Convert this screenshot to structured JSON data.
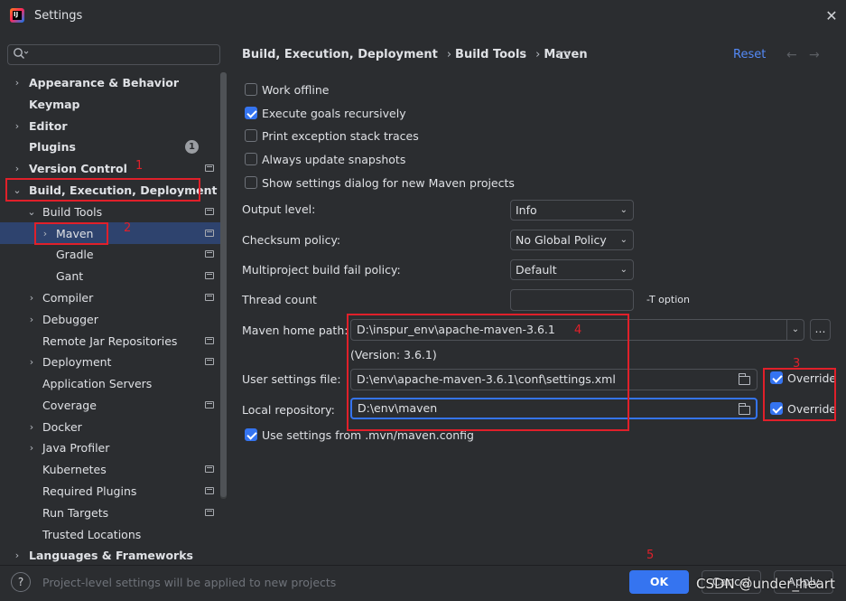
{
  "window": {
    "title": "Settings",
    "close": "✕",
    "app_icon_text": "IJ"
  },
  "sidebar": {
    "search_placeholder": "",
    "items": [
      {
        "label": "Appearance & Behavior",
        "expandable": true,
        "level": 0
      },
      {
        "label": "Keymap",
        "level": 0
      },
      {
        "label": "Editor",
        "expandable": true,
        "level": 0
      },
      {
        "label": "Plugins",
        "level": 0,
        "badge": "1"
      },
      {
        "label": "Version Control",
        "expandable": true,
        "level": 0
      },
      {
        "label": "Build, Execution, Deployment",
        "expanded": true,
        "level": 0
      },
      {
        "label": "Build Tools",
        "expanded": true,
        "level": 1
      },
      {
        "label": "Maven",
        "expandable": true,
        "level": 2,
        "selected": true
      },
      {
        "label": "Gradle",
        "level": 2
      },
      {
        "label": "Gant",
        "level": 2
      },
      {
        "label": "Compiler",
        "expandable": true,
        "level": 1
      },
      {
        "label": "Debugger",
        "expandable": true,
        "level": 1
      },
      {
        "label": "Remote Jar Repositories",
        "level": 1
      },
      {
        "label": "Deployment",
        "expandable": true,
        "level": 1
      },
      {
        "label": "Application Servers",
        "level": 1
      },
      {
        "label": "Coverage",
        "level": 1
      },
      {
        "label": "Docker",
        "expandable": true,
        "level": 1
      },
      {
        "label": "Java Profiler",
        "expandable": true,
        "level": 1
      },
      {
        "label": "Kubernetes",
        "level": 1
      },
      {
        "label": "Required Plugins",
        "level": 1
      },
      {
        "label": "Run Targets",
        "level": 1
      },
      {
        "label": "Trusted Locations",
        "level": 1
      },
      {
        "label": "Languages & Frameworks",
        "expandable": true,
        "level": 0
      }
    ]
  },
  "header": {
    "breadcrumb": [
      "Build, Execution, Deployment",
      "Build Tools",
      "Maven"
    ],
    "reset": "Reset",
    "back": "←",
    "forward": "→"
  },
  "maven": {
    "work_offline": {
      "label": "Work offline",
      "checked": false
    },
    "execute_recursive": {
      "label": "Execute goals recursively",
      "checked": true
    },
    "print_exception": {
      "label": "Print exception stack traces",
      "checked": false
    },
    "always_update": {
      "label": "Always update snapshots",
      "checked": false
    },
    "show_dialog": {
      "label": "Show settings dialog for new Maven projects",
      "checked": false
    },
    "output_level": {
      "label": "Output level:",
      "value": "Info"
    },
    "checksum_policy": {
      "label": "Checksum policy:",
      "value": "No Global Policy"
    },
    "multiproject_policy": {
      "label": "Multiproject build fail policy:",
      "value": "Default"
    },
    "thread_count": {
      "label": "Thread count",
      "value": "",
      "suffix": "-T option"
    },
    "home_path": {
      "label": "Maven home path:",
      "value": "D:\\inspur_env\\apache-maven-3.6.1",
      "version": "(Version: 3.6.1)",
      "browse": "..."
    },
    "user_settings": {
      "label": "User settings file:",
      "value": "D:\\env\\apache-maven-3.6.1\\conf\\settings.xml",
      "override_label": "Override",
      "override": true
    },
    "local_repo": {
      "label": "Local repository:",
      "value": "D:\\env\\maven",
      "override_label": "Override",
      "override": true
    },
    "use_mvn_config": {
      "label": "Use settings from .mvn/maven.config",
      "checked": true
    }
  },
  "annotations": [
    "1",
    "2",
    "3",
    "4",
    "5"
  ],
  "footer": {
    "help": "?",
    "note": "Project-level settings will be applied to new projects",
    "ok": "OK",
    "cancel": "Cancel",
    "apply": "Apply",
    "watermark": "CSDN @under_heart"
  },
  "colors": {
    "accent": "#3574f0",
    "annotation": "#e0202a",
    "link": "#548af7",
    "selected": "#2e436e"
  }
}
